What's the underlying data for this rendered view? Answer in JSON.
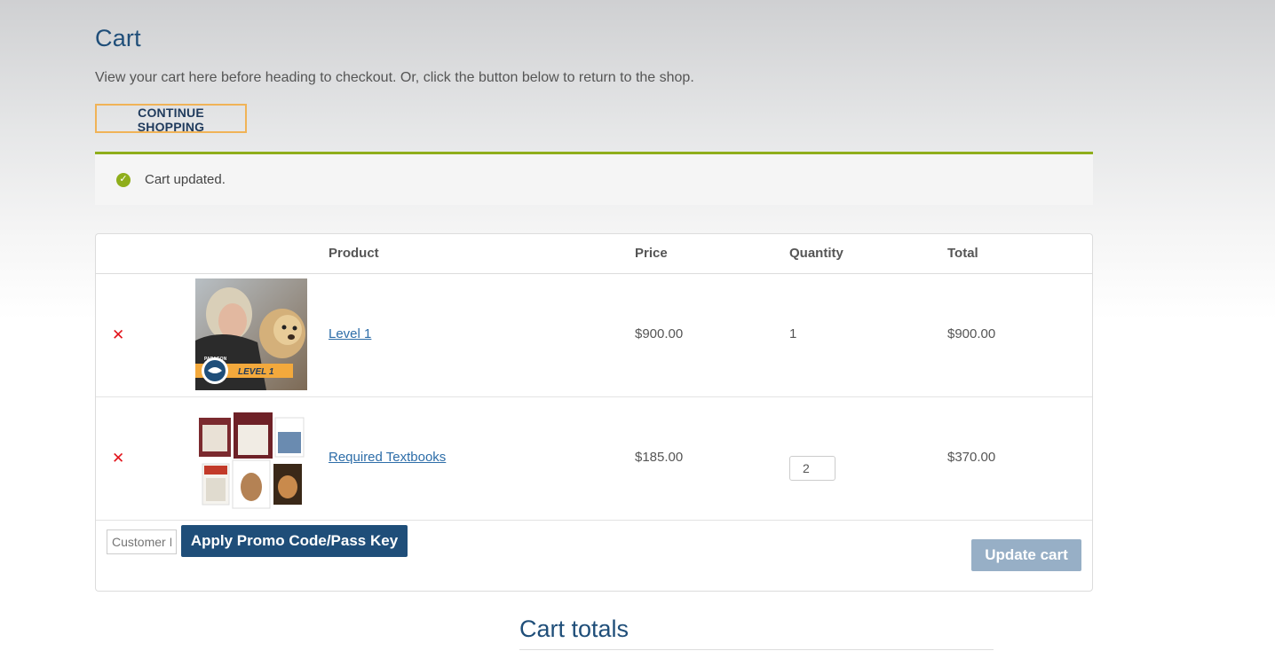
{
  "page": {
    "title": "Cart",
    "intro": "View your cart here before heading to checkout. Or, click the button below to return to the shop.",
    "continue_label": "CONTINUE SHOPPING"
  },
  "notice": {
    "message": "Cart updated.",
    "color": "#8fae1b"
  },
  "table": {
    "headers": {
      "product": "Product",
      "price": "Price",
      "quantity": "Quantity",
      "total": "Total"
    },
    "rows": [
      {
        "name": "Level 1",
        "price": "$900.00",
        "quantity": "1",
        "total": "$900.00",
        "thumb_badge": "LEVEL 1",
        "thumb_brand": "PARAGON"
      },
      {
        "name": "Required Textbooks",
        "price": "$185.00",
        "quantity": "2",
        "total": "$370.00"
      }
    ]
  },
  "actions": {
    "coupon_placeholder": "Customer I",
    "apply_label": "Apply Promo Code/Pass Key",
    "update_label": "Update cart"
  },
  "totals": {
    "title": "Cart totals"
  },
  "colors": {
    "brand": "#1f4e79",
    "accent_border": "#f0b357",
    "remove": "#e2131b",
    "link": "#2d6da8"
  },
  "icons": {
    "notice": "check-circle-icon",
    "remove": "remove-x-icon"
  }
}
